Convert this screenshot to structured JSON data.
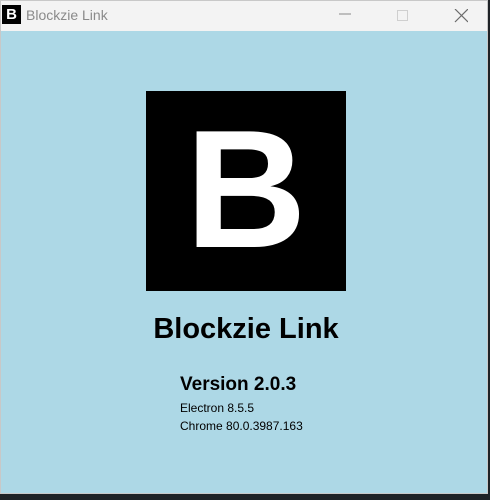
{
  "window": {
    "title": "Blockzie Link",
    "icon_letter": "B",
    "controls": {
      "minimize_icon": "minimize-icon",
      "maximize_icon": "maximize-icon",
      "close_icon": "close-icon"
    }
  },
  "about": {
    "logo_letter": "B",
    "app_name": "Blockzie Link",
    "version": "Version 2.0.3",
    "electron": "Electron 8.5.5",
    "chrome": "Chrome 80.0.3987.163"
  },
  "colors": {
    "background": "#add8e6",
    "titlebar": "#f3f3f3",
    "logo_bg": "#000000",
    "logo_fg": "#ffffff"
  }
}
